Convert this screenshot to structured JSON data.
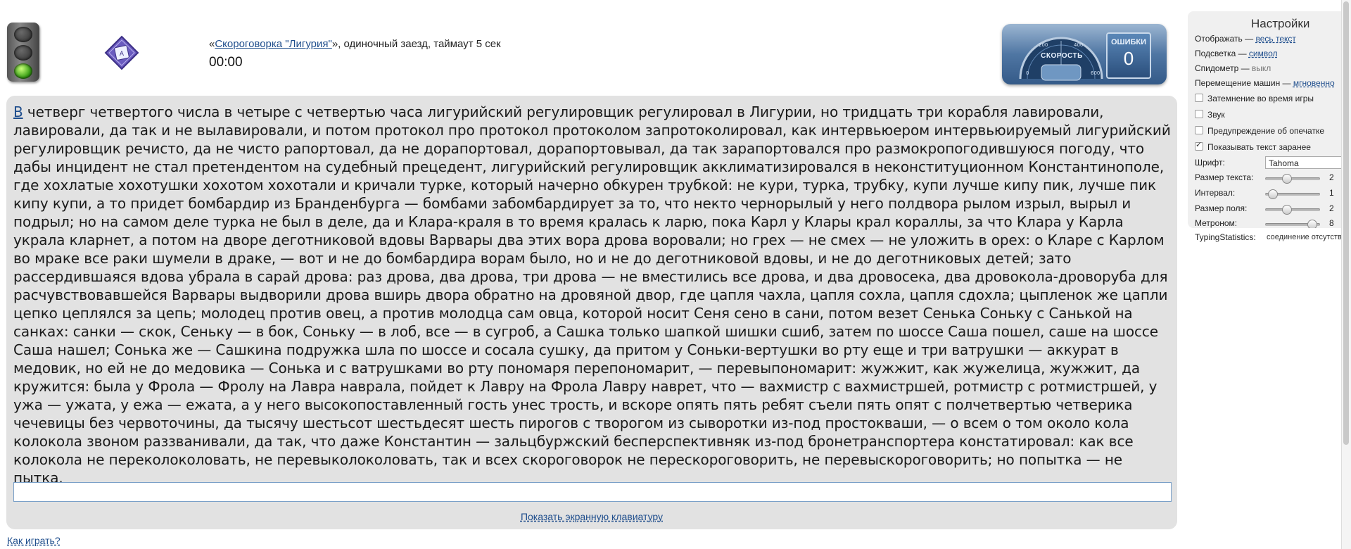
{
  "header": {
    "race_quote_open": "«",
    "race_link": "Скороговорка \"Лигурия\"",
    "race_quote_close": "»",
    "race_desc": ", одиночный заезд, таймаут 5 сек",
    "timer": "00:00"
  },
  "dashboard": {
    "speed_label": "СКОРОСТЬ",
    "gauge_ticks": [
      "0",
      "200",
      "400",
      "600"
    ],
    "errors_label": "ОШИБКИ",
    "errors_value": "0"
  },
  "settings": {
    "title": "Настройки",
    "display_label": "Отображать — ",
    "display_value": "весь текст",
    "highlight_label": "Подсветка — ",
    "highlight_value": "символ",
    "speedometer_label": "Спидометр — ",
    "speedometer_value": "выкл",
    "cars_label": "Перемещение машин — ",
    "cars_value": "мгновенно",
    "dim_label": "Затемнение во время игры",
    "dim_checked": false,
    "sound_label": "Звук",
    "sound_checked": false,
    "typo_label": "Предупреждение об опечатке",
    "typo_checked": false,
    "show_text_label": "Показывать текст заранее",
    "show_text_checked": true,
    "font_label": "Шрифт:",
    "font_value": "Tahoma",
    "text_size_label": "Размер текста:",
    "text_size_value": "2",
    "interval_label": "Интервал:",
    "interval_value": "1",
    "field_size_label": "Размер поля:",
    "field_size_value": "2",
    "metronome_label": "Метроном:",
    "metronome_value": "8",
    "typing_stats_label": "TypingStatistics:",
    "typing_stats_value": "соединение отсутствует"
  },
  "main": {
    "first_char": "В",
    "text": " четверг четвертого числа в четыре с четвертью часа лигурийский регулировщик регулировал в Лигурии, но тридцать три корабля лавировали, лавировали, да так и не вылавировали, и потом протокол про протокол протоколом запротоколировал, как интервьюером интервьюируемый лигурийский регулировщик речисто, да не чисто рапортовал, да не дорапортовал, дорапортовывал, да так зарапортовался про размокропогодившуюся погоду, что дабы инцидент не стал претендентом на судебный прецедент, лигурийский регулировщик акклиматизировался в неконституционном Константинополе, где хохлатые хохотушки хохотом хохотали и кричали турке, который начерно обкурен трубкой: не кури, турка, трубку, купи лучше кипу пик, лучше пик кипу купи, а то придет бомбардир из Бранденбурга — бомбами забомбардирует за то, что некто чернорылый у него полдвора рылом изрыл, вырыл и подрыл; но на самом деле турка не был в деле, да и Клара-краля в то время кралась к ларю, пока Карл у Клары крал кораллы, за что Клара у Карла украла кларнет, а потом на дворе деготниковой вдовы Варвары два этих вора дрова воровали; но грех — не смех — не уложить в орех: о Кларе с Карлом во мраке все раки шумели в драке, — вот и не до бомбардира ворам было, но и не до деготниковой вдовы, и не до деготниковых детей; зато рассердившаяся вдова убрала в сарай дрова: раз дрова, два дрова, три дрова — не вместились все дрова, и два дровосека, два дровокола-дроворуба для расчувствовавшейся Варвары выдворили дрова вширь двора обратно на дровяной двор, где цапля чахла, цапля сохла, цапля сдохла; цыпленок же цапли цепко цеплялся за цепь; молодец против овец, а против молодца сам овца, которой носит Сеня сено в сани, потом везет Сенька Соньку с Санькой на санках: санки — скок, Сеньку — в бок, Соньку — в лоб, все — в сугроб, а Сашка только шапкой шишки сшиб, затем по шоссе Саша пошел, саше на шоссе Саша нашел; Сонька же — Сашкина подружка шла по шоссе и сосала сушку, да притом у Соньки-вертушки во рту еще и три ватрушки — аккурат в медовик, но ей не до медовика — Сонька и с ватрушками во рту пономаря перепономарит, — перевыпономарит: жужжит, как жужелица, жужжит, да кружится: была у Фрола — Фролу на Лавра наврала, пойдет к Лавру на Фрола Лавру наврет, что — вахмистр с вахмистршей, ротмистр с ротмистршей, у ужа — ужата, у ежа — ежата, а у него высокопоставленный гость унес трость, и вскоре опять пять ребят съели пять опят с полчетвертью четверика чечевицы без червоточины, да тысячу шестьсот шестьдесят шесть пирогов с творогом из сыворотки из-под простокваши, — о всем о том около кола колокола звоном раззванивали, да так, что даже Константин — зальцбуржский бесперспективняк из-под бронетранспортера констатировал: как все колокола не переколоколовать, не перевыколоколовать, так и всех скороговорок не перескороговорить, не перевыскороговорить; но попытка — не пытка.",
    "input_value": "",
    "show_keyboard": "Показать экранную клавиатуру"
  },
  "footer": {
    "how_to_play": "Как играть?"
  }
}
